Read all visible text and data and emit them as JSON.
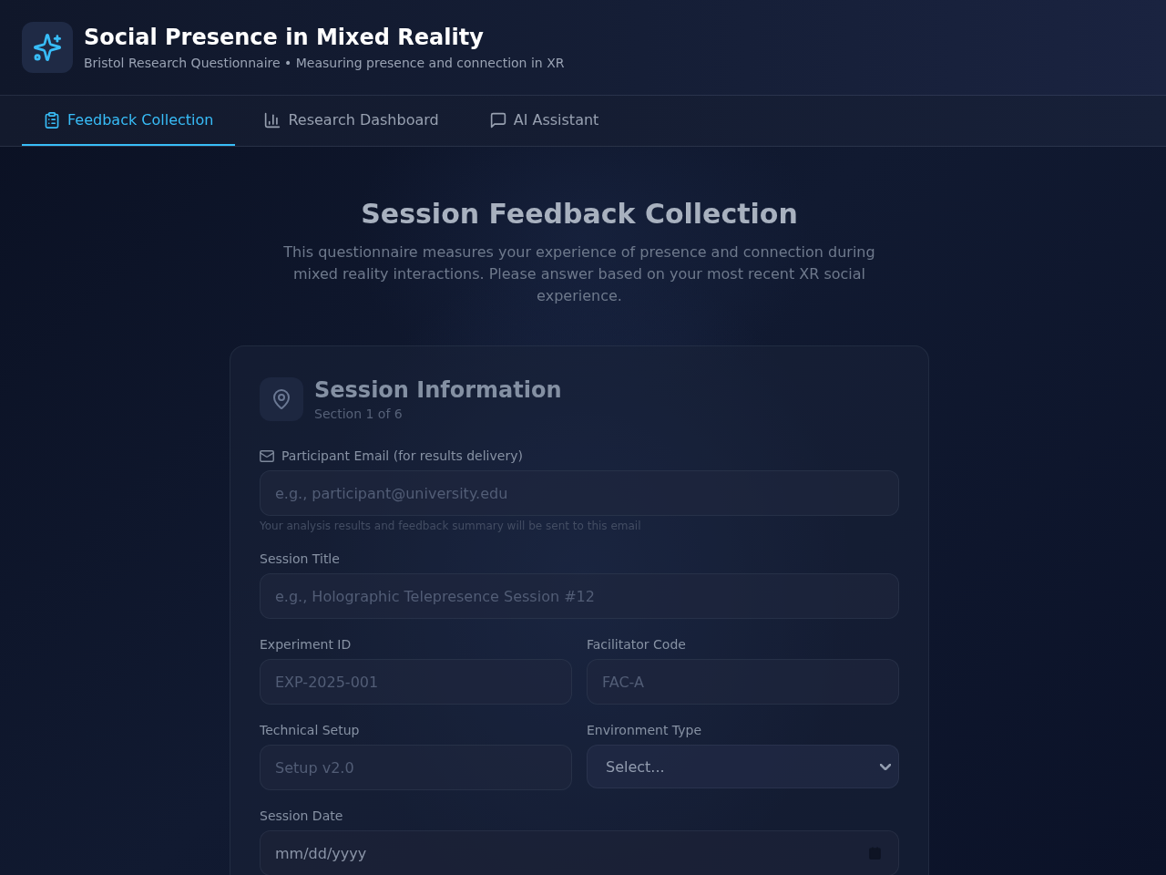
{
  "header": {
    "title": "Social Presence in Mixed Reality",
    "subtitle": "Bristol Research Questionnaire • Measuring presence and connection in XR"
  },
  "tabs": [
    {
      "label": "Feedback Collection",
      "selected": true
    },
    {
      "label": "Research Dashboard",
      "selected": false
    },
    {
      "label": "AI Assistant",
      "selected": false
    }
  ],
  "page": {
    "heading": "Session Feedback Collection",
    "intro": "This questionnaire measures your experience of presence and connection during mixed reality interactions. Please answer based on your most recent XR social experience."
  },
  "section": {
    "title": "Session Information",
    "counter": "Section 1 of 6",
    "rows": [
      [
        {
          "kind": "email",
          "label": "Participant Email (for results delivery)",
          "placeholder": "e.g., participant@university.edu",
          "hint": "Your analysis results and feedback summary will be sent to this email"
        }
      ],
      [
        {
          "kind": "text",
          "label": "Session Title",
          "placeholder": "e.g., Holographic Telepresence Session #12"
        }
      ],
      [
        {
          "kind": "text",
          "label": "Experiment ID",
          "placeholder": "EXP-2025-001"
        },
        {
          "kind": "text",
          "label": "Facilitator Code",
          "placeholder": "FAC-A"
        }
      ],
      [
        {
          "kind": "text",
          "label": "Technical Setup",
          "placeholder": "Setup v2.0"
        },
        {
          "kind": "select",
          "label": "Environment Type",
          "placeholder": "Select..."
        }
      ],
      [
        {
          "kind": "date",
          "label": "Session Date",
          "placeholder": "mm/dd/yyyy"
        }
      ]
    ]
  }
}
